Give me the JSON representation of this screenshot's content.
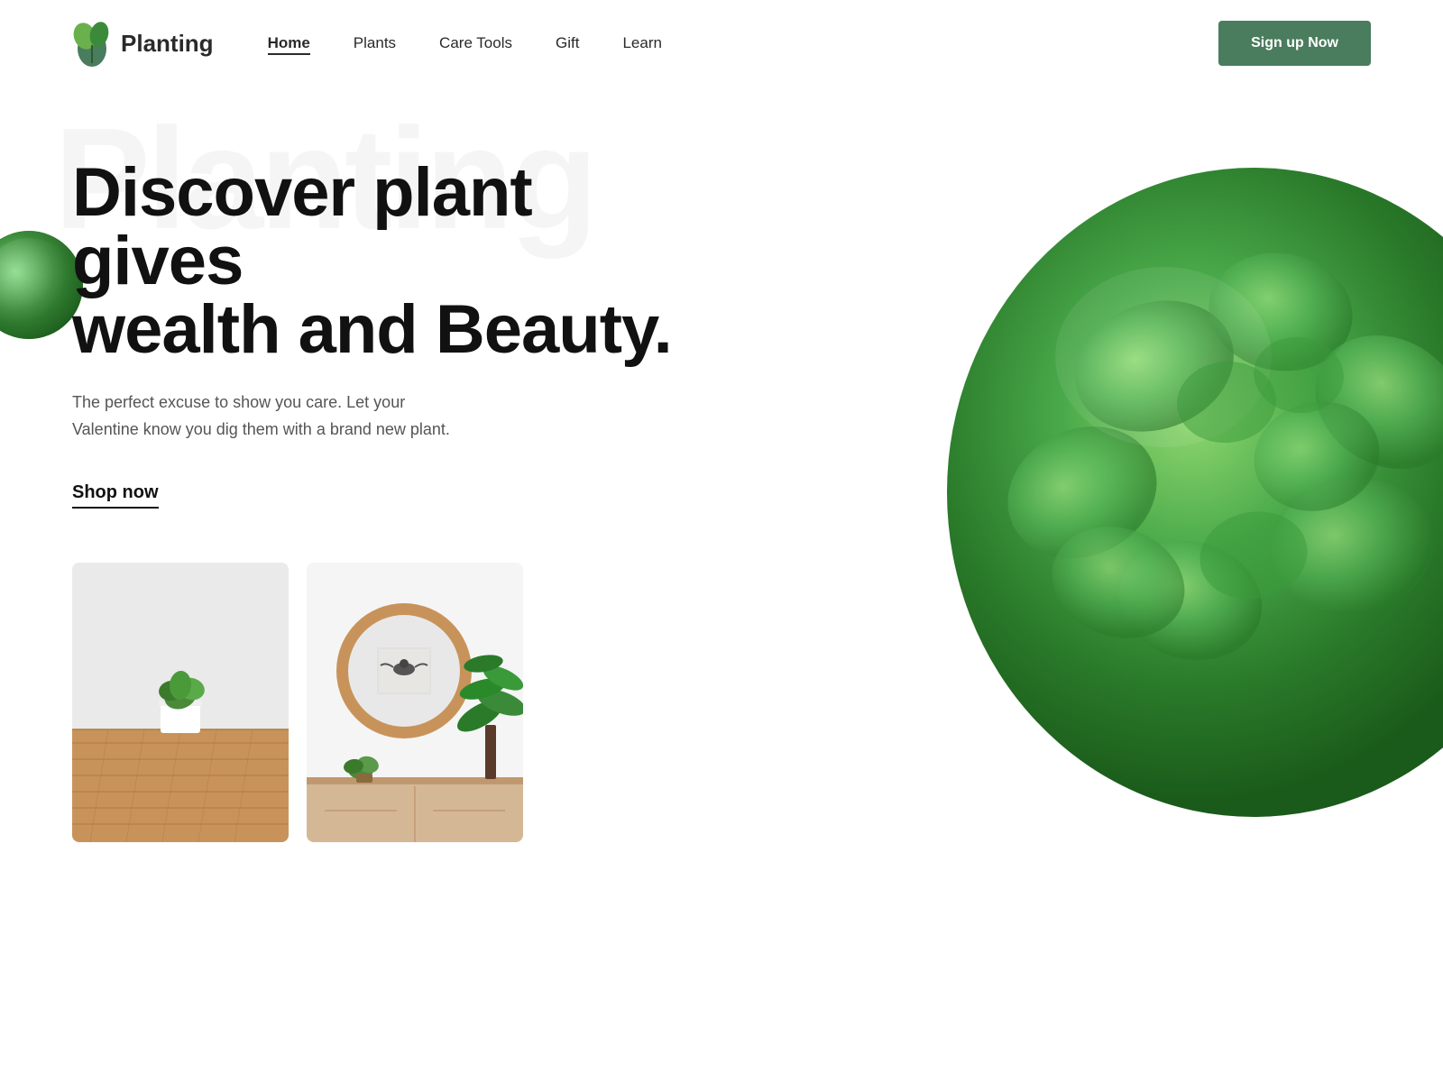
{
  "brand": {
    "name": "Planting",
    "logo_alt": "Planting logo leaf icon"
  },
  "nav": {
    "links": [
      {
        "id": "home",
        "label": "Home",
        "active": true
      },
      {
        "id": "plants",
        "label": "Plants",
        "active": false
      },
      {
        "id": "care-tools",
        "label": "Care Tools",
        "active": false
      },
      {
        "id": "gift",
        "label": "Gift",
        "active": false
      },
      {
        "id": "learn",
        "label": "Learn",
        "active": false
      }
    ],
    "cta_label": "Sign up Now"
  },
  "hero": {
    "watermark": "Planting",
    "headline_line1": "Discover plant gives",
    "headline_line2": "wealth and Beauty.",
    "subtext": "The  perfect excuse to show you care. Let your Valentine know you dig them with a brand new plant.",
    "shop_now": "Shop now"
  },
  "colors": {
    "nav_cta_bg": "#4a7c5e",
    "headline_color": "#111111",
    "subtext_color": "#555555",
    "watermark_color": "rgba(0,0,0,0.04)"
  }
}
